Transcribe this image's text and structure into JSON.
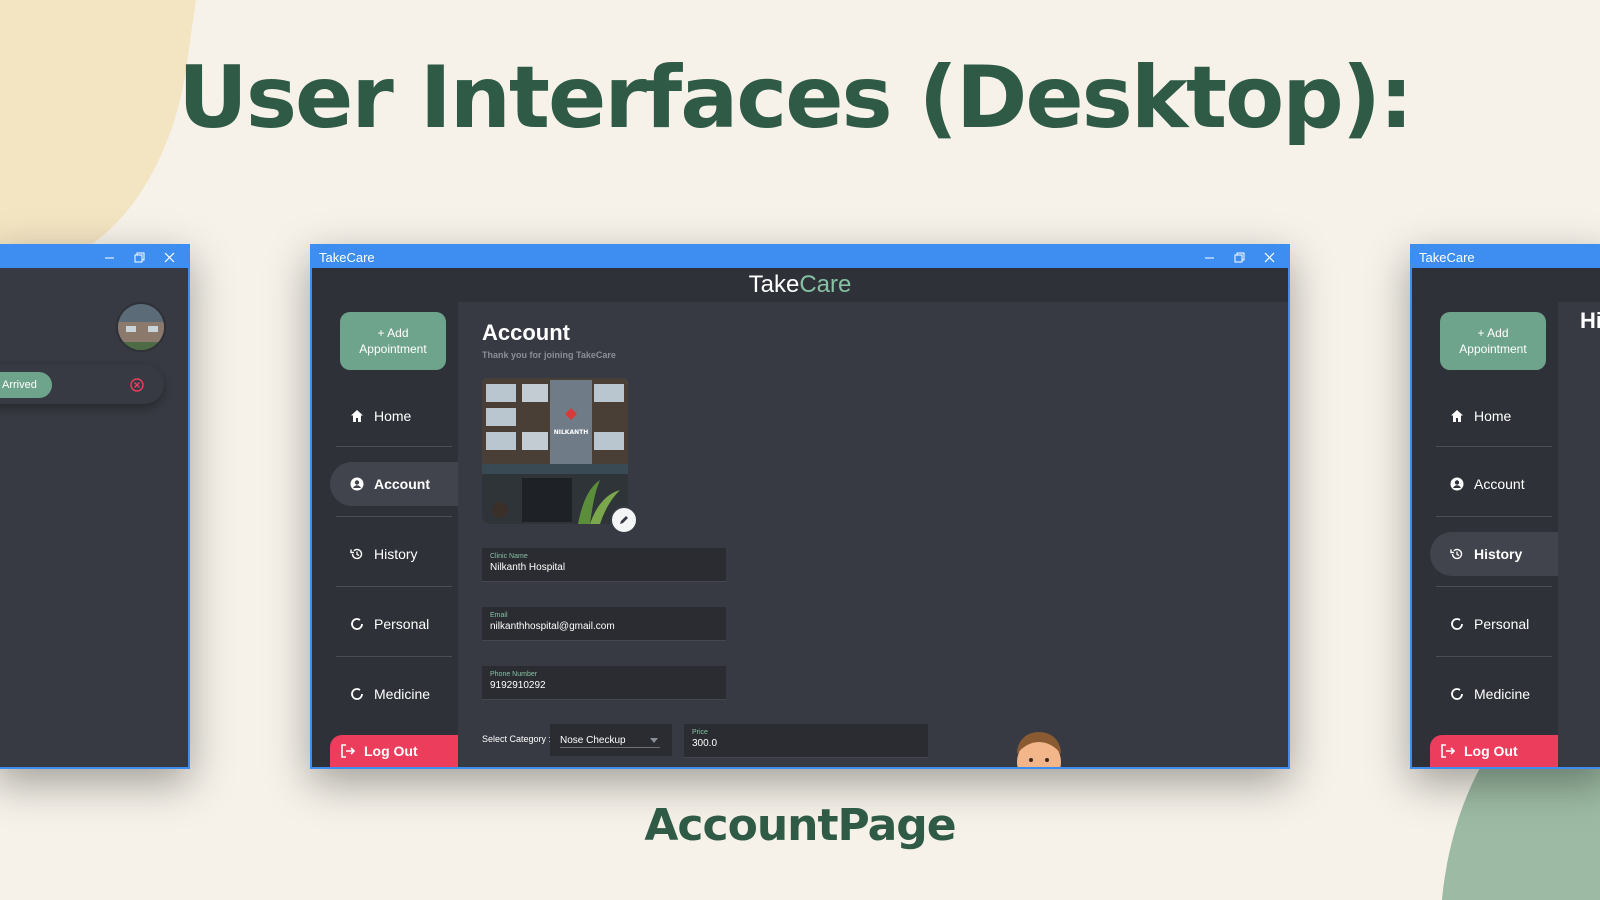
{
  "page": {
    "headline": "User Interfaces (Desktop):",
    "caption": "AccountPage"
  },
  "window": {
    "title": "TakeCare",
    "brand_take": "Take",
    "brand_care": "Care"
  },
  "sidebar": {
    "add_button": "+ Add Appointment",
    "items": [
      {
        "label": "Home",
        "icon": "home-icon"
      },
      {
        "label": "Account",
        "icon": "account-icon"
      },
      {
        "label": "History",
        "icon": "history-icon"
      },
      {
        "label": "Personal",
        "icon": "personal-icon"
      },
      {
        "label": "Medicine",
        "icon": "medicine-icon"
      }
    ],
    "logout": "Log Out"
  },
  "account": {
    "title": "Account",
    "subtitle": "Thank you for joining TakeCare",
    "photo_sign": "NILKANTH",
    "clinic_name_label": "Clinic Name",
    "clinic_name": "Nilkanth Hospital",
    "email_label": "Email",
    "email": "nilkanthhospital@gmail.com",
    "phone_label": "Phone Number",
    "phone": "9192910292",
    "category_label": "Select Category :",
    "category_value": "Nose Checkup",
    "price_label": "Price",
    "price": "300.0"
  },
  "left_window": {
    "status": "Arrived"
  },
  "right_window": {
    "heading_partial": "Hi",
    "active_item": "History"
  },
  "colors": {
    "accent": "#6fa48c",
    "titlebar": "#3d8ef0",
    "logout": "#ec3d5d",
    "headline": "#2f5a46"
  }
}
